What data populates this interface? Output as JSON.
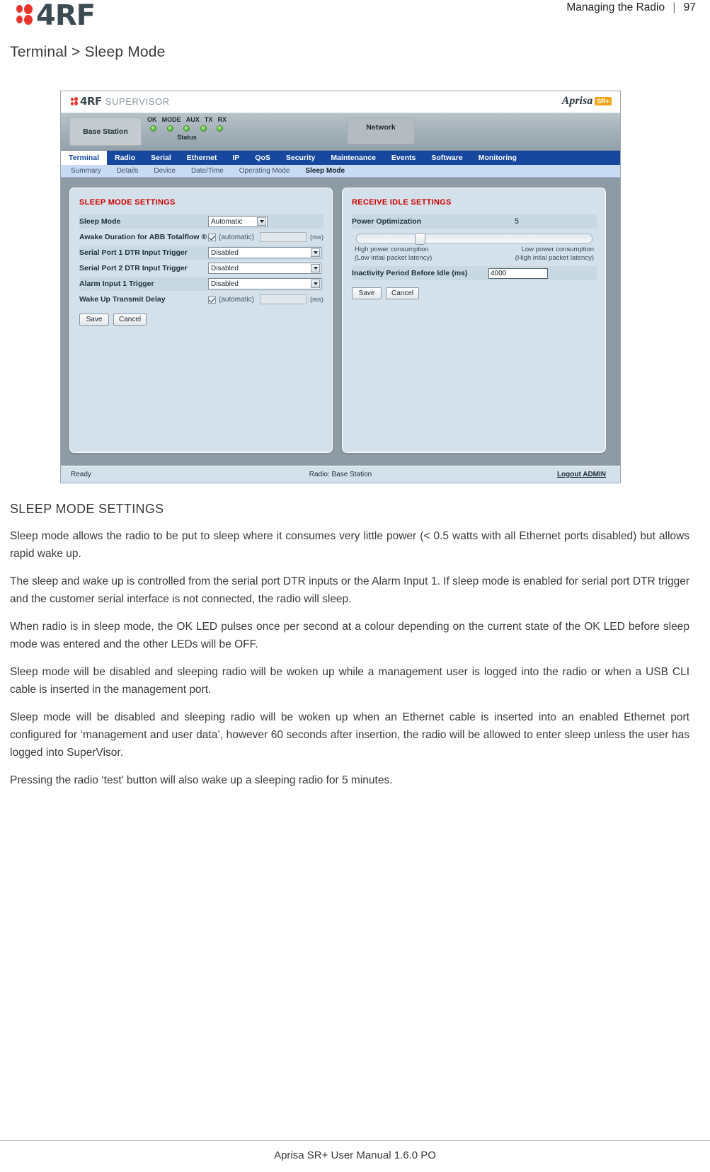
{
  "header": {
    "logo_text": "4RF",
    "running_head": "Managing the Radio",
    "separator": "|",
    "page_number": "97"
  },
  "doc_title": "Terminal > Sleep Mode",
  "screenshot": {
    "brand": {
      "product_name": "4RF",
      "product_suffix": "SUPERVISOR",
      "model_word": "Aprisa",
      "model_badge": "SR+"
    },
    "status_band": {
      "radio_name": "Base Station",
      "network_label": "Network",
      "status_caption": "Status",
      "leds": [
        {
          "label": "OK",
          "color": "#4fbb36"
        },
        {
          "label": "MODE",
          "color": "#4fbb36"
        },
        {
          "label": "AUX",
          "color": "#4fbb36"
        },
        {
          "label": "TX",
          "color": "#4fbb36"
        },
        {
          "label": "RX",
          "color": "#4fbb36"
        }
      ]
    },
    "nav_tabs": [
      {
        "label": "Terminal",
        "active": true
      },
      {
        "label": "Radio",
        "active": false
      },
      {
        "label": "Serial",
        "active": false
      },
      {
        "label": "Ethernet",
        "active": false
      },
      {
        "label": "IP",
        "active": false
      },
      {
        "label": "QoS",
        "active": false
      },
      {
        "label": "Security",
        "active": false
      },
      {
        "label": "Maintenance",
        "active": false
      },
      {
        "label": "Events",
        "active": false
      },
      {
        "label": "Software",
        "active": false
      },
      {
        "label": "Monitoring",
        "active": false
      }
    ],
    "sub_tabs": [
      {
        "label": "Summary",
        "active": false
      },
      {
        "label": "Details",
        "active": false
      },
      {
        "label": "Device",
        "active": false
      },
      {
        "label": "Date/Time",
        "active": false
      },
      {
        "label": "Operating Mode",
        "active": false
      },
      {
        "label": "Sleep Mode",
        "active": true
      }
    ],
    "sleep_panel": {
      "title": "SLEEP MODE SETTINGS",
      "rows": [
        {
          "label": "Sleep Mode",
          "type": "select-small",
          "value": "Automatic"
        },
        {
          "label": "Awake Duration for ABB Totalflow ®",
          "type": "auto-check",
          "checkbox_label": "(automatic)",
          "checked": true,
          "value": "",
          "unit": "(ms)"
        },
        {
          "label": "Serial Port 1 DTR Input Trigger",
          "type": "select-wide",
          "value": "Disabled"
        },
        {
          "label": "Serial Port 2 DTR Input Trigger",
          "type": "select-wide",
          "value": "Disabled"
        },
        {
          "label": "Alarm Input 1 Trigger",
          "type": "select-wide",
          "value": "Disabled"
        },
        {
          "label": "Wake Up Transmit Delay",
          "type": "auto-check",
          "checkbox_label": "(automatic)",
          "checked": true,
          "value": "",
          "unit": "(ms)"
        }
      ],
      "save_label": "Save",
      "cancel_label": "Cancel"
    },
    "idle_panel": {
      "title": "RECEIVE IDLE SETTINGS",
      "power_optimization_label": "Power Optimization",
      "power_optimization_value": "5",
      "slider_left_primary": "High power consumption",
      "slider_left_secondary": "(Low intial packet latency)",
      "slider_right_primary": "Low power consumption",
      "slider_right_secondary": "(High intial packet latency)",
      "inactivity_label": "Inactivity Period Before Idle (ms)",
      "inactivity_value": "4000",
      "save_label": "Save",
      "cancel_label": "Cancel"
    },
    "footer": {
      "status": "Ready",
      "radio": "Radio: Base Station",
      "logout": "Logout ADMIN"
    }
  },
  "section": {
    "heading": "SLEEP MODE SETTINGS",
    "paragraphs": [
      "Sleep mode allows the radio to be put to sleep where it consumes very little power (< 0.5 watts with all Ethernet ports disabled) but allows rapid wake up.",
      "The sleep and wake up is controlled from the serial port DTR inputs or the Alarm Input 1. If sleep mode is enabled for serial port DTR trigger and the customer serial interface is not connected, the radio will sleep.",
      "When radio is in sleep mode, the OK LED pulses once per second at a colour depending on the current state of the OK LED before sleep mode was entered and the other LEDs will be OFF.",
      "Sleep mode will be disabled and sleeping radio will be woken up while a management user is logged into the radio or when a USB CLI cable is inserted in the management port.",
      "Sleep mode will be disabled and sleeping radio will be woken up when an Ethernet cable is inserted into an enabled Ethernet port configured for ‘management and user data’, however 60 seconds after insertion, the radio will be allowed to enter sleep unless the user has logged into SuperVisor.",
      "Pressing the radio ‘test’ button will also wake up a sleeping radio for 5 minutes."
    ]
  },
  "page_footer": {
    "text": "Aprisa SR+ User Manual 1.6.0 PO"
  },
  "colors": {
    "brand_red": "#e8352b",
    "nav_blue": "#17489e",
    "panel_title_red": "#cc0000",
    "led_green": "#4fbb36",
    "badge_orange": "#f3a41a"
  }
}
